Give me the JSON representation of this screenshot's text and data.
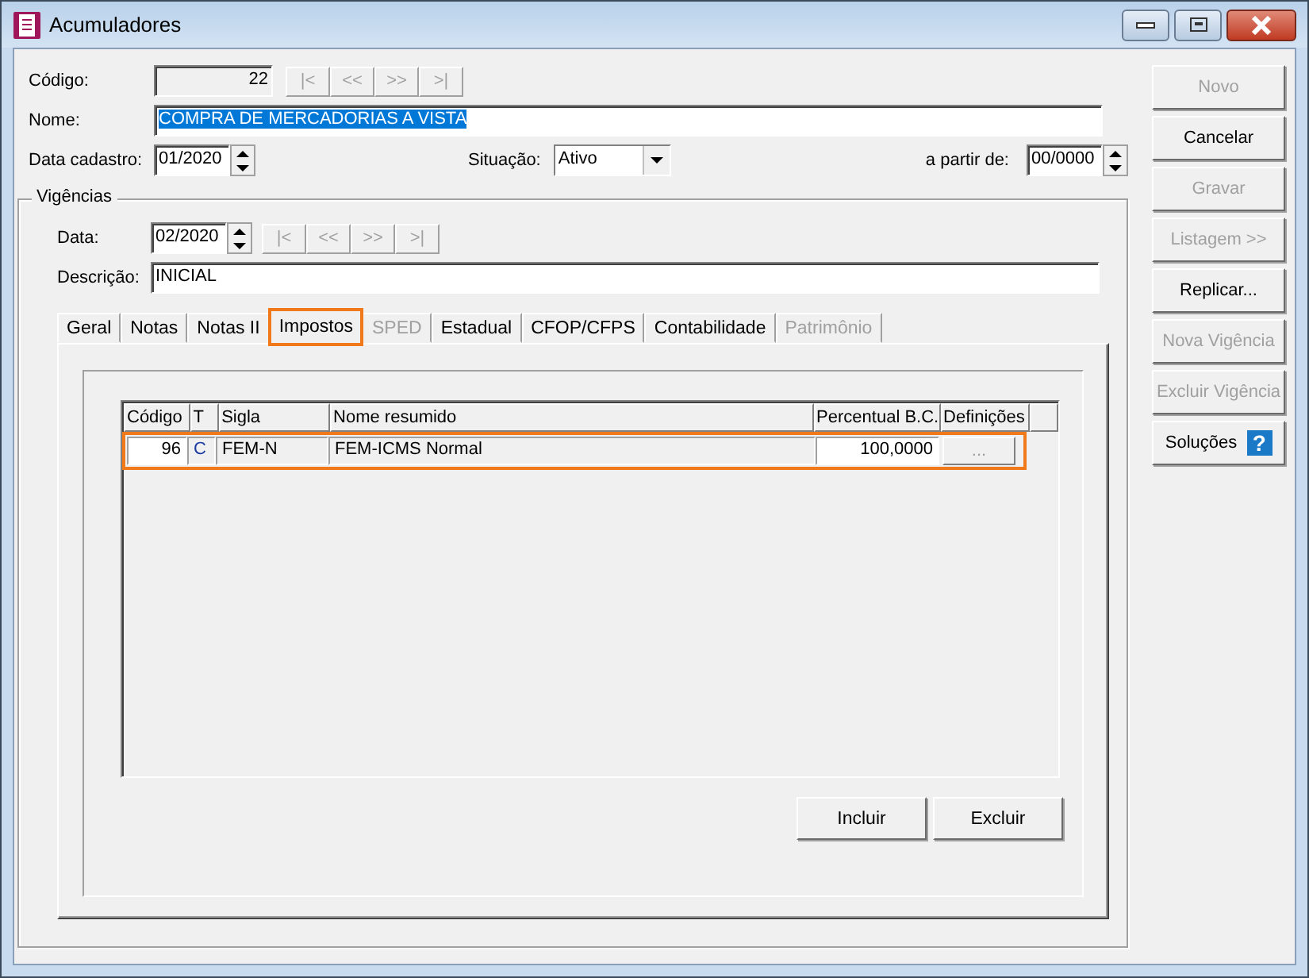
{
  "window": {
    "title": "Acumuladores"
  },
  "form": {
    "codigo": {
      "label": "Código:",
      "value": "22"
    },
    "nav_buttons": [
      {
        "label": "|<",
        "disabled": true
      },
      {
        "label": "<<",
        "disabled": true
      },
      {
        "label": ">>",
        "disabled": true
      },
      {
        "label": ">|",
        "disabled": true
      }
    ],
    "nome": {
      "label": "Nome:",
      "value": "COMPRA DE MERCADORIAS A VISTA",
      "text_selected": true
    },
    "data_cadastro": {
      "label": "Data cadastro:",
      "value": "01/2020"
    },
    "situacao": {
      "label": "Situação:",
      "value": "Ativo"
    },
    "a_partir_de": {
      "label": "a partir de:",
      "value": "00/0000"
    }
  },
  "vigencias": {
    "title": "Vigências",
    "data": {
      "label": "Data:",
      "value": "02/2020"
    },
    "nav_buttons": [
      {
        "label": "|<",
        "disabled": true
      },
      {
        "label": "<<",
        "disabled": true
      },
      {
        "label": ">>",
        "disabled": true
      },
      {
        "label": ">|",
        "disabled": true
      }
    ],
    "descricao": {
      "label": "Descrição:",
      "value": "INICIAL"
    },
    "tabs": [
      {
        "label": "Geral",
        "selected": false,
        "disabled": false,
        "highlighted": false
      },
      {
        "label": "Notas",
        "selected": false,
        "disabled": false,
        "highlighted": false
      },
      {
        "label": "Notas II",
        "selected": false,
        "disabled": false,
        "highlighted": false
      },
      {
        "label": "Impostos",
        "selected": true,
        "disabled": false,
        "highlighted": true
      },
      {
        "label": "SPED",
        "selected": false,
        "disabled": true,
        "highlighted": false
      },
      {
        "label": "Estadual",
        "selected": false,
        "disabled": false,
        "highlighted": false
      },
      {
        "label": "CFOP/CFPS",
        "selected": false,
        "disabled": false,
        "highlighted": false
      },
      {
        "label": "Contabilidade",
        "selected": false,
        "disabled": false,
        "highlighted": false
      },
      {
        "label": "Patrimônio",
        "selected": false,
        "disabled": true,
        "highlighted": false
      }
    ],
    "table": {
      "columns": [
        "Código",
        "T",
        "Sigla",
        "Nome resumido",
        "Percentual B.C.",
        "Definições"
      ],
      "rows": [
        {
          "codigo": "96",
          "t": "C",
          "sigla": "FEM-N",
          "nome_resumido": "FEM-ICMS Normal",
          "percentual_bc": "100,0000",
          "definicoes": "...",
          "highlighted": true
        }
      ]
    },
    "buttons": [
      {
        "label": "Incluir"
      },
      {
        "label": "Excluir"
      }
    ]
  },
  "side_buttons": [
    {
      "label": "Novo",
      "disabled": true,
      "kind": "plain"
    },
    {
      "label": "Cancelar",
      "disabled": false,
      "kind": "plain"
    },
    {
      "label": "Gravar",
      "disabled": true,
      "kind": "plain"
    },
    {
      "label": "Listagem >>",
      "disabled": true,
      "kind": "plain"
    },
    {
      "label": "Replicar...",
      "disabled": false,
      "kind": "plain"
    },
    {
      "label": "Nova Vigência",
      "disabled": true,
      "kind": "plain"
    },
    {
      "label": "Excluir Vigência",
      "disabled": true,
      "kind": "plain"
    },
    {
      "label": "Soluções",
      "disabled": false,
      "kind": "help",
      "icon_glyph": "?"
    }
  ]
}
